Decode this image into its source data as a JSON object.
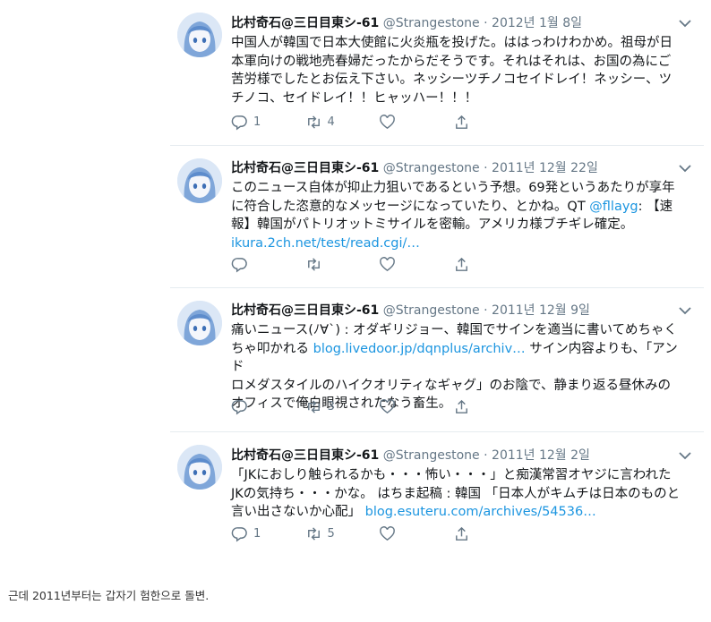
{
  "tweets": [
    {
      "name": "比村奇石@三日目東シ-61",
      "handle": "@Strangestone",
      "sep": "·",
      "date": "2012년 1월 8일",
      "lines": [
        "中国人が韓国で日本大使館に火炎瓶を投げた。ははっわけわかめ。祖母が日",
        "本軍向けの戦地売春婦だったからだそうです。それはそれは、お国の為にご",
        "苦労様でしたとお伝え下さい。ネッシーツチノコセイドレイ！ネッシー、ツ",
        "チノコ、セイドレイ！！ヒャッハー！！！"
      ],
      "reply_count": "1",
      "retweet_count": "4",
      "like_count": ""
    },
    {
      "name": "比村奇石@三日目東シ-61",
      "handle": "@Strangestone",
      "sep": "·",
      "date": "2011년 12월 22일",
      "line1": "このニュース自体が抑止力狙いであるという予想。69発というあたりが享年",
      "line2": "に符合した恣意的なメッセージになっていたり、とかね。QT ",
      "mention": "@fllayg",
      "line2b": ": 【速",
      "line3": "報】韓国がパトリオットミサイルを密輸。アメリカ様ブチギレ確定。",
      "link": "ikura.2ch.net/test/read.cgi/…",
      "reply_count": "",
      "retweet_count": "",
      "like_count": ""
    },
    {
      "name": "比村奇石@三日目東シ-61",
      "handle": "@Strangestone",
      "sep": "·",
      "date": "2011년 12월 9일",
      "line1": "痛いニュース(ﾉ∀`) : オダギリジョー、韓国でサインを適当に書いてめちゃく",
      "line2a": "ちゃ叩かれる ",
      "link": "blog.livedoor.jp/dqnplus/archiv…",
      "line2b": " サイン内容よりも、「アンド",
      "line3": "ロメダスタイルのハイクオリティなギャグ」のお陰で、静まり返る昼休みの",
      "line4": "オフィスで俺白眼視されたなう畜生。",
      "reply_count": "",
      "retweet_count": "3",
      "like_count": ""
    },
    {
      "name": "比村奇石@三日目東シ-61",
      "handle": "@Strangestone",
      "sep": "·",
      "date": "2011년 12월 2일",
      "line1": "「JKにおしり触られるかも・・・怖い・・・」と痴漢常習オヤジに言われた",
      "line2": "JKの気持ち・・・かな。 はちま起稿 : 韓国 「日本人がキムチは日本のものと",
      "line3a": "言い出さないか心配」 ",
      "link": "blog.esuteru.com/archives/54536…",
      "reply_count": "1",
      "retweet_count": "5",
      "like_count": ""
    }
  ],
  "caption": "근데 2011년부터는 갑자기 험한으로 돌변.",
  "colors": {
    "link": "#1b95e0",
    "muted": "#657786",
    "border": "#e6ecf0"
  },
  "icons": [
    "reply-icon",
    "retweet-icon",
    "like-icon",
    "share-icon",
    "chevron-down-icon"
  ]
}
